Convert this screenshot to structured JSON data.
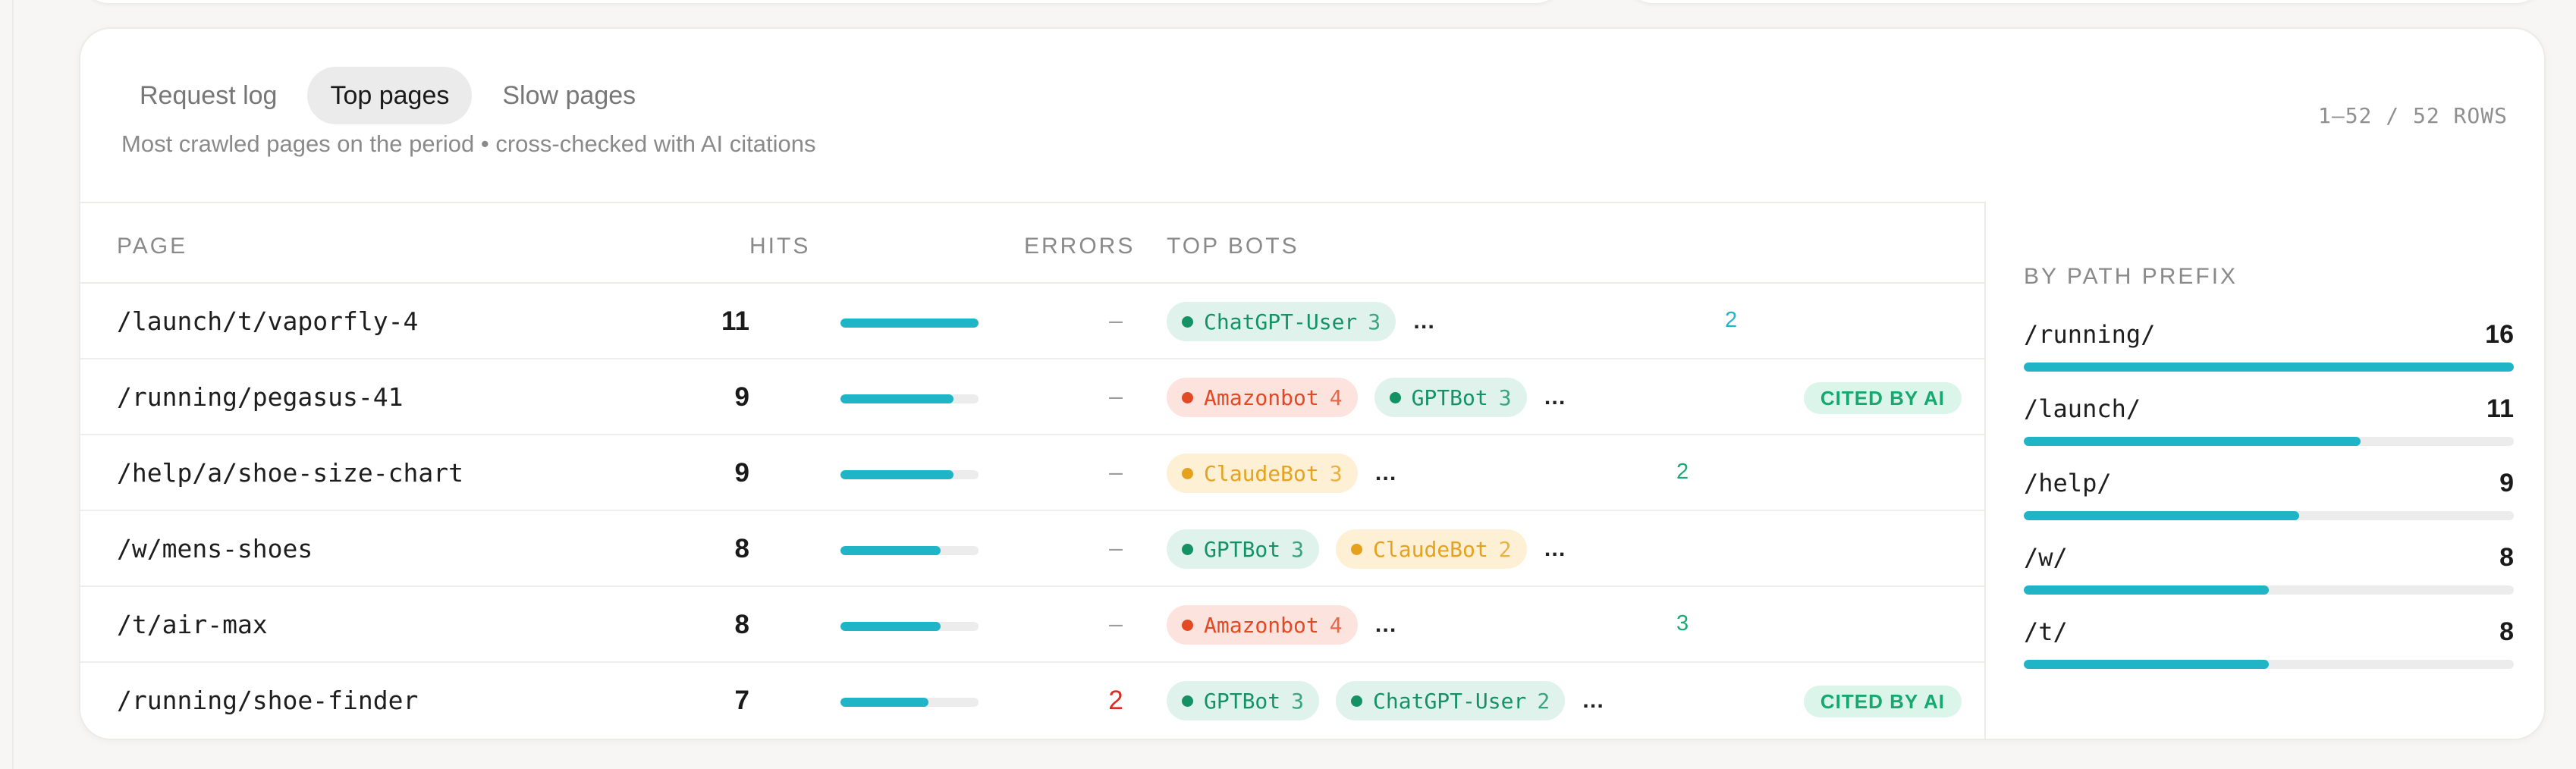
{
  "tabs": [
    {
      "label": "Request log",
      "active": false
    },
    {
      "label": "Top pages",
      "active": true
    },
    {
      "label": "Slow pages",
      "active": false
    }
  ],
  "subtitle": "Most crawled pages on the period • cross-checked with AI citations",
  "rows_count": "1–52 / 52 ROWS",
  "columns": {
    "page": "PAGE",
    "hits": "HITS",
    "errors": "ERRORS",
    "top_bots": "TOP BOTS"
  },
  "hits_max": 11,
  "rows": [
    {
      "page": "/launch/t/vaporfly-4",
      "hits": "11",
      "hits_value": 11,
      "errors": "–",
      "errors_bad": false,
      "bots": [
        {
          "name": "ChatGPT-User",
          "count": "3",
          "color": "green"
        }
      ],
      "more": "…",
      "extra": "2",
      "extra_color": "teal",
      "cited": ""
    },
    {
      "page": "/running/pegasus-41",
      "hits": "9",
      "hits_value": 9,
      "errors": "–",
      "errors_bad": false,
      "bots": [
        {
          "name": "Amazonbot",
          "count": "4",
          "color": "red"
        },
        {
          "name": "GPTBot",
          "count": "3",
          "color": "green"
        }
      ],
      "more": "…",
      "extra": "",
      "extra_color": "",
      "cited": "CITED BY AI"
    },
    {
      "page": "/help/a/shoe-size-chart",
      "hits": "9",
      "hits_value": 9,
      "errors": "–",
      "errors_bad": false,
      "bots": [
        {
          "name": "ClaudeBot",
          "count": "3",
          "color": "orange"
        }
      ],
      "more": "…",
      "extra": "2",
      "extra_color": "green",
      "cited": ""
    },
    {
      "page": "/w/mens-shoes",
      "hits": "8",
      "hits_value": 8,
      "errors": "–",
      "errors_bad": false,
      "bots": [
        {
          "name": "GPTBot",
          "count": "3",
          "color": "green"
        },
        {
          "name": "ClaudeBot",
          "count": "2",
          "color": "orange"
        }
      ],
      "more": "…",
      "extra": "",
      "extra_color": "",
      "cited": ""
    },
    {
      "page": "/t/air-max",
      "hits": "8",
      "hits_value": 8,
      "errors": "–",
      "errors_bad": false,
      "bots": [
        {
          "name": "Amazonbot",
          "count": "4",
          "color": "red"
        }
      ],
      "more": "…",
      "extra": "3",
      "extra_color": "green",
      "cited": ""
    },
    {
      "page": "/running/shoe-finder",
      "hits": "7",
      "hits_value": 7,
      "errors": "2",
      "errors_bad": true,
      "bots": [
        {
          "name": "GPTBot",
          "count": "3",
          "color": "green"
        },
        {
          "name": "ChatGPT-User",
          "count": "2",
          "color": "green"
        }
      ],
      "more": "…",
      "extra": "",
      "extra_color": "",
      "cited": "CITED BY AI"
    }
  ],
  "by_prefix": {
    "title": "BY PATH PREFIX",
    "max": 16,
    "items": [
      {
        "prefix": "/running/",
        "count": "16",
        "value": 16
      },
      {
        "prefix": "/launch/",
        "count": "11",
        "value": 11
      },
      {
        "prefix": "/help/",
        "count": "9",
        "value": 9
      },
      {
        "prefix": "/w/",
        "count": "8",
        "value": 8
      },
      {
        "prefix": "/t/",
        "count": "8",
        "value": 8
      }
    ]
  },
  "colors": {
    "accent": "#1fb5c7",
    "error": "#e02a20",
    "cited_bg": "#dcf5ea",
    "cited_text": "#16a96f"
  }
}
